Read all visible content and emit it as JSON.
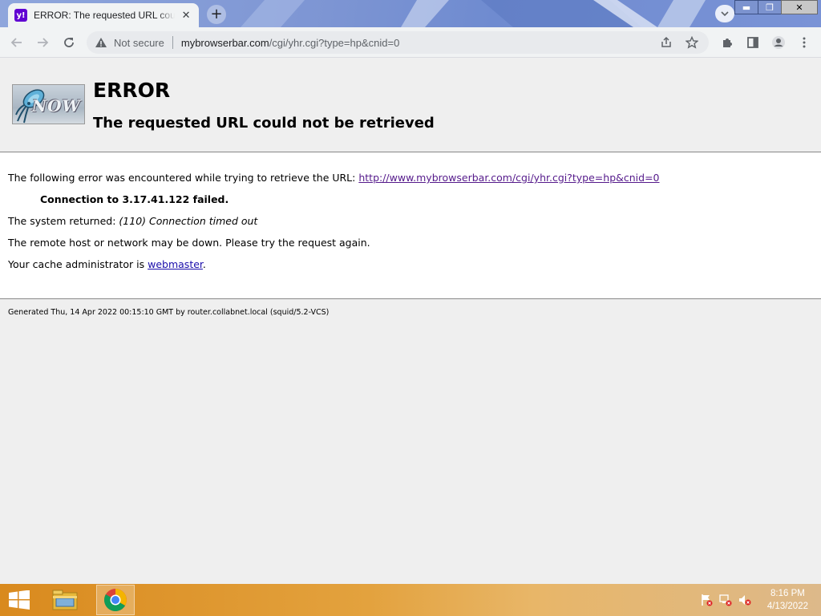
{
  "browser": {
    "tab_title": "ERROR: The requested URL could not be retrieved",
    "tab_favicon": "y!",
    "security_label": "Not secure",
    "url_host": "mybrowserbar.com",
    "url_path": "/cgi/yhr.cgi?type=hp&cnid=0",
    "window_controls": {
      "minimize": "▬",
      "restore": "❐",
      "close": "✕"
    }
  },
  "page": {
    "logo_text": "NOW",
    "heading": "ERROR",
    "subheading": "The requested URL could not be retrieved",
    "line1_prefix": "The following error was encountered while trying to retrieve the URL: ",
    "line1_link": "http://www.mybrowserbar.com/cgi/yhr.cgi?type=hp&cnid=0",
    "connection_failed": "Connection to 3.17.41.122 failed.",
    "system_returned_prefix": "The system returned: ",
    "system_returned_value": "(110) Connection timed out",
    "remote_host_msg": "The remote host or network may be down. Please try the request again.",
    "cache_admin_prefix": "Your cache administrator is ",
    "cache_admin_link": "webmaster",
    "cache_admin_suffix": ".",
    "footer": "Generated Thu, 14 Apr 2022 00:15:10 GMT by router.collabnet.local (squid/5.2-VCS)"
  },
  "taskbar": {
    "apps": [
      "file-explorer-icon",
      "chrome-icon"
    ],
    "tray_icons": [
      "action-center-flag-icon",
      "network-icon",
      "volume-muted-icon"
    ],
    "time": "8:16 PM",
    "date": "4/13/2022"
  },
  "colors": {
    "link": "#1a0dab",
    "visited_link": "#551a8b",
    "tab_favicon_bg": "#6001d2"
  }
}
